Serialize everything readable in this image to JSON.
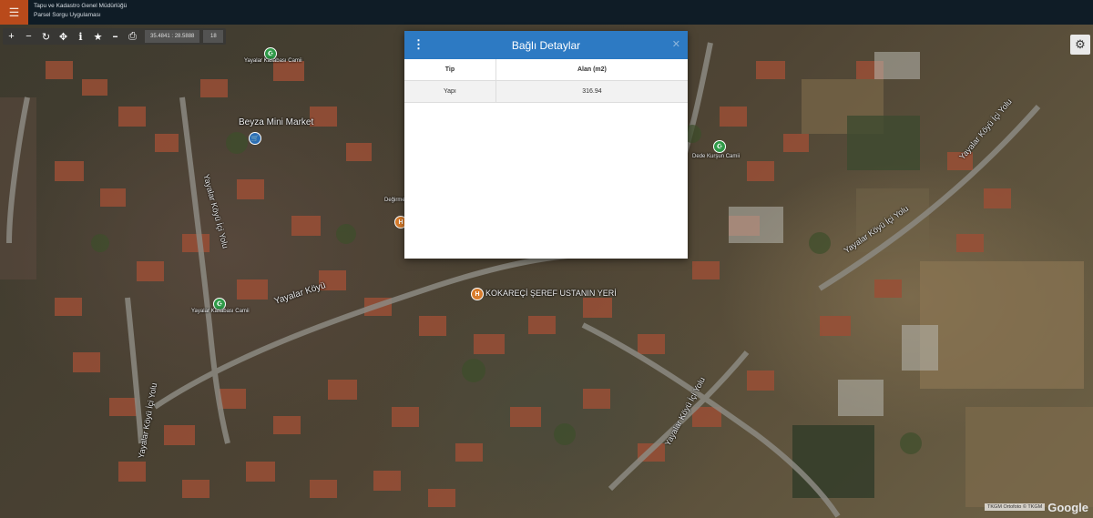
{
  "header": {
    "menu_icon": "hamburger-icon",
    "title_line1": "Tapu ve Kadastro Genel Müdürlüğü",
    "title_line2": "Parsel Sorgu Uygulaması",
    "brand_color": "#b94a1b"
  },
  "toolbar": {
    "tools": [
      {
        "name": "zoom-in-icon",
        "glyph": "+"
      },
      {
        "name": "zoom-out-icon",
        "glyph": "−"
      },
      {
        "name": "refresh-icon",
        "glyph": "↻"
      },
      {
        "name": "locate-icon",
        "glyph": "✥"
      },
      {
        "name": "info-icon",
        "glyph": "i"
      },
      {
        "name": "star-icon",
        "glyph": "★"
      },
      {
        "name": "minus-icon",
        "glyph": "━"
      },
      {
        "name": "print-icon",
        "glyph": "⎙"
      }
    ],
    "coordinates": "35.4841 : 28.5888",
    "zoom_level": "18"
  },
  "map": {
    "roads": [
      "Yayalar Köyü",
      "Yayalar Köyü İçi Yolu",
      "Yayalar Köyü İçi Yolu",
      "Yayalar Köyü İçi Yolu",
      "Yayalar Köyü İçi Yolu",
      "Yayalar Köyü İçi Yolu"
    ],
    "pois": {
      "market": "Beyza Mini Market",
      "school": "KOKAREÇİ ŞEREF USTANIN YERİ",
      "mosque1": "Yayalar Kasabası Camii",
      "mosque2": "Yayalar Kasabası Camii",
      "mosque3": "Dede Kurşun Camii",
      "place1": "Değirmen Pastası"
    },
    "attribution": "TKGM Ortofoto © TKGM",
    "google": "Google"
  },
  "modal": {
    "title": "Bağlı Detaylar",
    "header_color": "#2d7ac3",
    "columns": [
      "Tip",
      "Alan (m2)"
    ],
    "rows": [
      [
        "Yapı",
        "316.94"
      ]
    ]
  }
}
